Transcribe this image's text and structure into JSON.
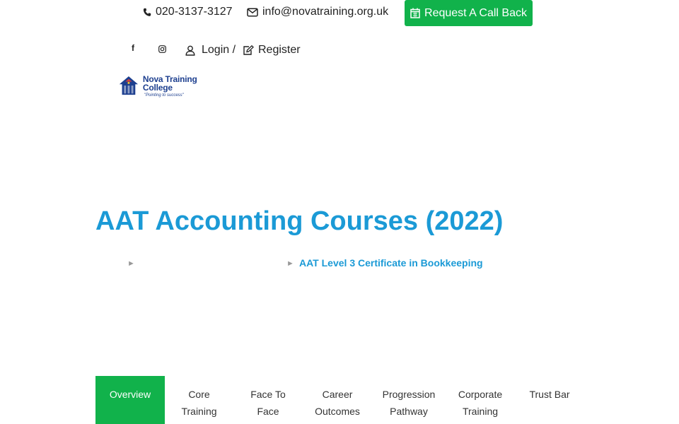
{
  "topbar": {
    "phone": "020-3137-3127",
    "email": "info@novatraining.org.uk",
    "cta_label": "Request A Call Back"
  },
  "account": {
    "login_label": "Login /",
    "register_label": "Register"
  },
  "social": {
    "facebook_glyph": "f",
    "instagram_icon": "instagram-icon"
  },
  "logo": {
    "name": "Nova Training College",
    "tagline": "\"Pointing to success\""
  },
  "page": {
    "title": "AAT Accounting Courses (2022)"
  },
  "breadcrumb": {
    "separator": "►",
    "current": "AAT Level 3 Certificate in Bookkeeping"
  },
  "tabs": [
    {
      "line1": "Overview",
      "line2": "",
      "active": true
    },
    {
      "line1": "Core",
      "line2": "Training",
      "active": false
    },
    {
      "line1": "Face To",
      "line2": "Face",
      "active": false
    },
    {
      "line1": "Career",
      "line2": "Outcomes",
      "active": false
    },
    {
      "line1": "Progression",
      "line2": "Pathway",
      "active": false
    },
    {
      "line1": "Corporate",
      "line2": "Training",
      "active": false
    },
    {
      "line1": "Trust Bar",
      "line2": "",
      "active": false
    }
  ],
  "colors": {
    "accent_green": "#11b24b",
    "title_blue": "#1b9ad6",
    "logo_navy": "#1d3f8f"
  }
}
